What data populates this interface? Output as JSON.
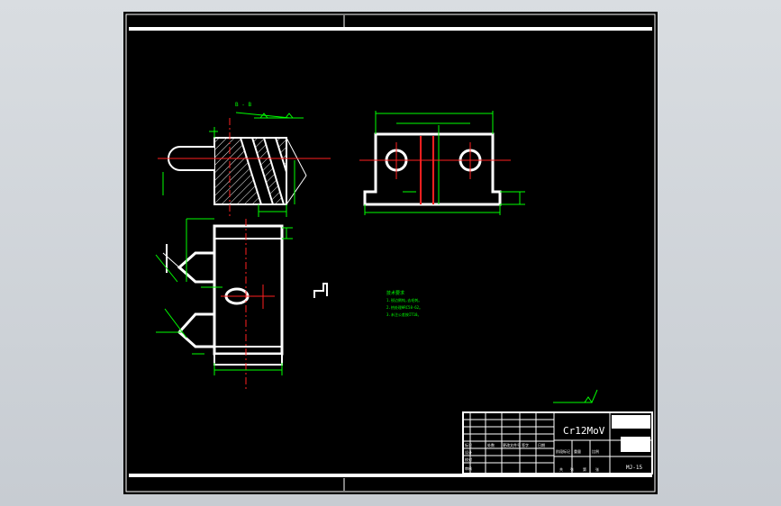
{
  "material": "Cr12MoV",
  "section_label": "B - B",
  "drawing_number": "MJ-15",
  "tech_req": {
    "title": "技术要求",
    "lines": [
      "1.锐边倒钝,去毛刺。",
      "2.热处理HRC58-62。",
      "3.未注公差按IT10。"
    ]
  },
  "title_block": {
    "header": [
      "标记",
      "处数",
      "更改文件号",
      "签字",
      "日期"
    ],
    "rows": [
      "设计",
      "校对",
      "审核"
    ],
    "mid": [
      "阶段标记",
      "重量",
      "比例"
    ],
    "bottom": [
      "共",
      "张",
      "第",
      "张"
    ]
  },
  "colors": {
    "sheet": "#000000",
    "outline": "#ffffff",
    "dim": "#00ff00",
    "center": "#ff2020",
    "aux": "#00ffff"
  }
}
